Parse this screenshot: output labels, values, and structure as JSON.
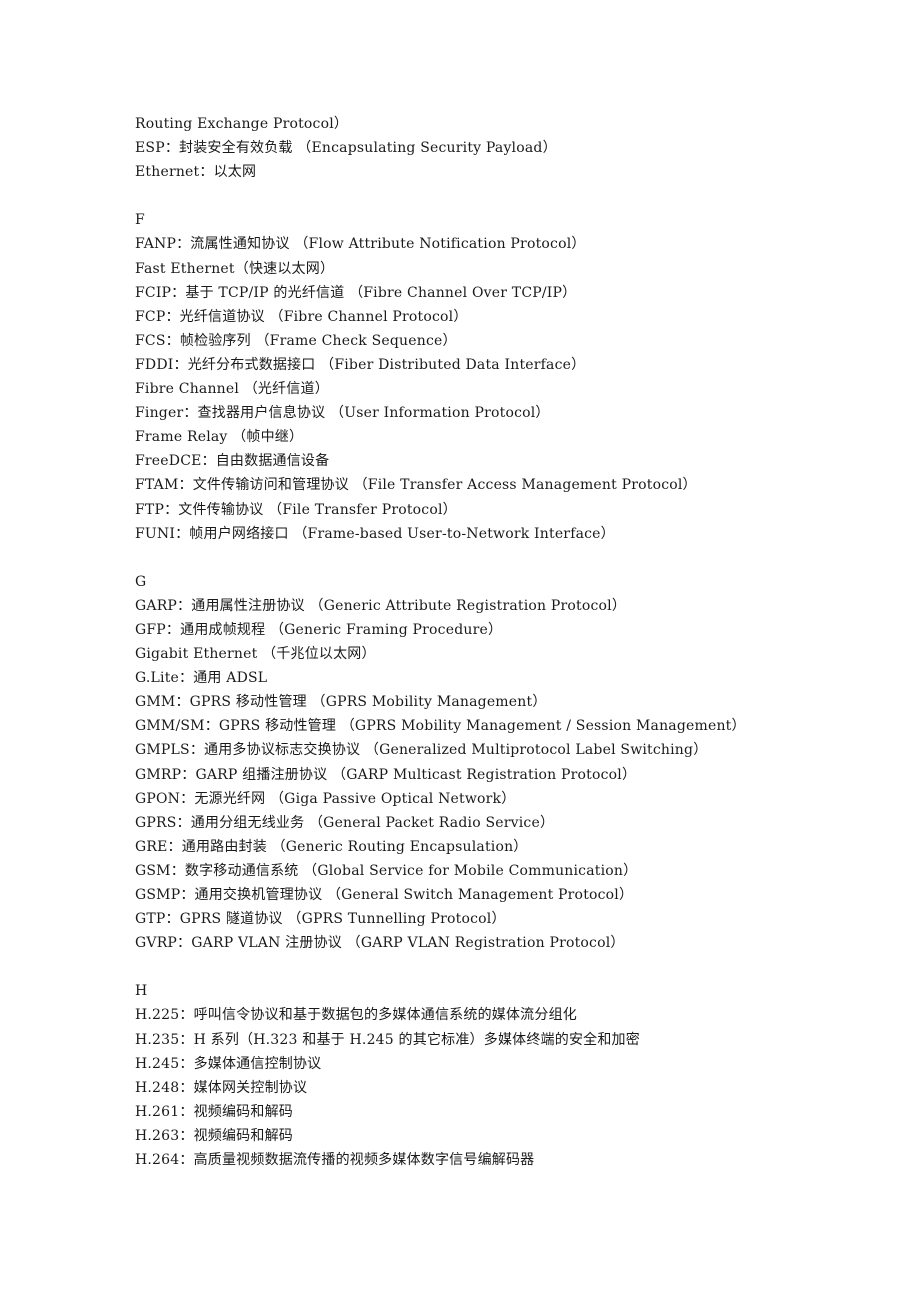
{
  "document": {
    "sections": [
      {
        "heading": null,
        "entries": [
          "Routing Exchange Protocol）",
          "ESP：封装安全有效负载 （Encapsulating Security Payload）",
          "Ethernet：以太网"
        ]
      },
      {
        "heading": "F",
        "entries": [
          "FANP：流属性通知协议 （Flow Attribute Notification Protocol）",
          "Fast Ethernet（快速以太网）",
          "FCIP：基于 TCP/IP 的光纤信道 （Fibre Channel Over TCP/IP）",
          "FCP：光纤信道协议 （Fibre Channel Protocol）",
          "FCS：帧检验序列 （Frame Check Sequence）",
          "FDDI：光纤分布式数据接口 （Fiber Distributed Data Interface）",
          "Fibre Channel （光纤信道）",
          "Finger：查找器用户信息协议 （User Information Protocol）",
          "Frame Relay （帧中继）",
          "FreeDCE：自由数据通信设备",
          "FTAM：文件传输访问和管理协议 （File Transfer Access Management Protocol）",
          "FTP：文件传输协议 （File Transfer Protocol）",
          "FUNI：帧用户网络接口 （Frame-based User-to-Network Interface）"
        ]
      },
      {
        "heading": "G",
        "entries": [
          "GARP：通用属性注册协议 （Generic Attribute Registration Protocol）",
          "GFP：通用成帧规程 （Generic Framing Procedure）",
          "Gigabit Ethernet （千兆位以太网）",
          "G.Lite：通用 ADSL",
          "GMM：GPRS 移动性管理 （GPRS Mobility Management）",
          "GMM/SM：GPRS 移动性管理 （GPRS Mobility Management / Session Management）",
          "GMPLS：通用多协议标志交换协议 （Generalized Multiprotocol Label Switching）",
          "GMRP：GARP 组播注册协议 （GARP Multicast Registration Protocol）",
          "GPON：无源光纤网 （Giga Passive Optical Network）",
          "GPRS：通用分组无线业务 （General Packet Radio Service）",
          "GRE：通用路由封装 （Generic Routing Encapsulation）",
          "GSM：数字移动通信系统 （Global Service for Mobile Communication）",
          "GSMP：通用交换机管理协议 （General Switch Management Protocol）",
          "GTP：GPRS 隧道协议 （GPRS Tunnelling Protocol）",
          "GVRP：GARP VLAN 注册协议 （GARP VLAN Registration Protocol）"
        ]
      },
      {
        "heading": "H",
        "entries": [
          "H.225：呼叫信令协议和基于数据包的多媒体通信系统的媒体流分组化",
          "H.235：H 系列（H.323 和基于 H.245 的其它标准）多媒体终端的安全和加密",
          "H.245：多媒体通信控制协议",
          "H.248：媒体网关控制协议",
          "H.261：视频编码和解码",
          "H.263：视频编码和解码",
          "H.264：高质量视频数据流传播的视频多媒体数字信号编解码器"
        ]
      }
    ]
  }
}
